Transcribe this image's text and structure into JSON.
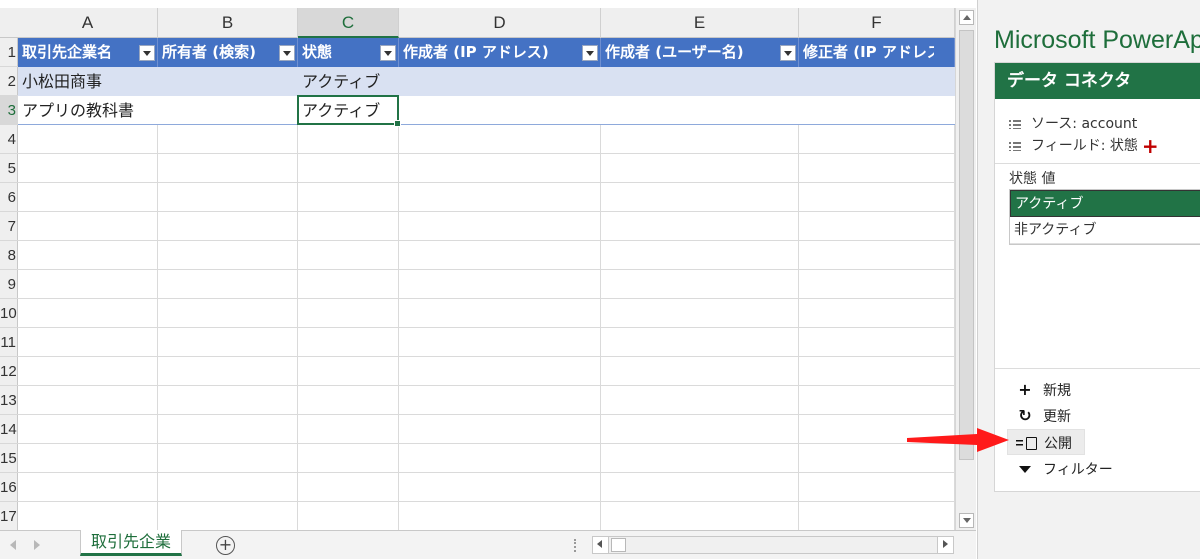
{
  "sheet": {
    "columns": [
      "A",
      "B",
      "C",
      "D",
      "E",
      "F"
    ],
    "selected_column": "C",
    "row_numbers": [
      "1",
      "2",
      "3",
      "4",
      "5",
      "6",
      "7",
      "8",
      "9",
      "10",
      "11",
      "12",
      "13",
      "14",
      "15",
      "16",
      "17"
    ],
    "selected_row": "3",
    "table_headers": [
      "取引先企業名",
      "所有者 (検索)",
      "状態",
      "作成者 (IP アドレス)",
      "作成者 (ユーザー名)",
      "修正者 (IP アドレス"
    ],
    "rows": [
      [
        "小松田商事",
        "",
        "アクティブ",
        "",
        "",
        ""
      ],
      [
        "アプリの教科書",
        "",
        "アクティブ",
        "",
        "",
        ""
      ]
    ],
    "header_color": "#4472c4",
    "band_color": "#d9e1f2",
    "accent_color": "#217346"
  },
  "tabs": {
    "active_tab": "取引先企業",
    "add_label": "+"
  },
  "pane": {
    "title": "Microsoft PowerApps Office アドイン",
    "connector_title": "データ コネクタ",
    "source_text": "ソース: account",
    "field_text": "フィールド: 状態",
    "values_label": "状態 値",
    "values": [
      "アクティブ",
      "非アクティブ"
    ],
    "selected_value": "アクティブ",
    "actions": [
      {
        "label": "新規",
        "icon": "plus-icon"
      },
      {
        "label": "更新",
        "icon": "refresh-icon"
      },
      {
        "label": "公開",
        "icon": "publish-icon"
      },
      {
        "label": "フィルター",
        "icon": "filter-icon"
      }
    ],
    "highlighted_action": "公開",
    "annotation_color": "#ff1a1a"
  }
}
